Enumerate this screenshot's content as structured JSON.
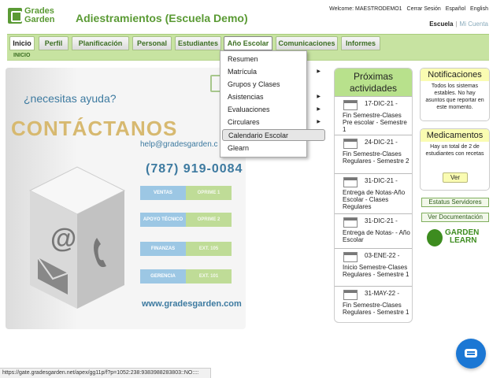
{
  "header": {
    "logo_line1": "Grades",
    "logo_line2": "Garden",
    "title": "Adiestramientos (Escuela Demo)",
    "welcome": "Welcome: MAESTRODEMO1",
    "logout": "Cerrar Sesión",
    "lang_es": "Español",
    "lang_en": "English",
    "school_current": "Escuela",
    "school_separator": "|",
    "school_link": "Mi Cuenta"
  },
  "nav": {
    "tabs": [
      "Inicio",
      "Perfil",
      "Planificación",
      "Personal",
      "Estudiantes",
      "Año Escolar",
      "Comunicaciones",
      "Informes"
    ],
    "active": "Inicio",
    "open": "Año Escolar",
    "breadcrumb": "INICIO"
  },
  "dropdown": {
    "items": [
      {
        "label": "Resumen",
        "submenu": false
      },
      {
        "label": "Matrícula",
        "submenu": true
      },
      {
        "label": "Grupos y Clases",
        "submenu": false
      },
      {
        "label": "Asistencias",
        "submenu": true
      },
      {
        "label": "Evaluaciones",
        "submenu": true
      },
      {
        "label": "Circulares",
        "submenu": true
      },
      {
        "label": "Calendario Escolar",
        "submenu": false
      },
      {
        "label": "Glearn",
        "submenu": false
      }
    ],
    "highlighted": "Calendario Escolar",
    "submenu_arrow": "▶"
  },
  "promo": {
    "help": "¿necesitas ayuda?",
    "contact": "CONTÁCTANOS",
    "email": "help@gradesgarden.c",
    "phone": "(787) 919-0084",
    "rows": [
      {
        "label": "VENTAS",
        "value": "OPRIME 1"
      },
      {
        "label": "APOYO TÉCNICO",
        "value": "OPRIME 2"
      },
      {
        "label": "FINANZAS",
        "value": "EXT. 105"
      },
      {
        "label": "GERENCIA",
        "value": "EXT. 101"
      }
    ],
    "website": "www.gradesgarden.com"
  },
  "activities": {
    "title_line1": "Próximas",
    "title_line2": "actividades",
    "items": [
      {
        "date": "17-DIC-21 -",
        "desc": "Fin Semestre-Clases Pre escolar - Semestre 1"
      },
      {
        "date": "24-DIC-21 -",
        "desc": "Fin Semestre-Clases Regulares - Semestre 2"
      },
      {
        "date": "31-DIC-21 -",
        "desc": "Entrega de Notas-Año Escolar - Clases Regulares"
      },
      {
        "date": "31-DIC-21 -",
        "desc": "Entrega de Notas- - Año Escolar"
      },
      {
        "date": "03-ENE-22 -",
        "desc": "Inicio Semestre-Clases Regulares - Semestre 1"
      },
      {
        "date": "31-MAY-22 -",
        "desc": "Fin Semestre-Clases Regulares - Semestre 1"
      }
    ]
  },
  "notifications": {
    "title": "Notificaciones",
    "body": "Todos los sistemas estables. No hay asuntos que reportar en este momento."
  },
  "medications": {
    "title": "Medicamentos",
    "body": "Hay un total de 2 de estudiantes con recetas",
    "button": "Ver"
  },
  "side_buttons": {
    "status": "Estatus Servidores",
    "docs": "Ver Documentación"
  },
  "garden_learn": {
    "line1": "GARDEN",
    "line2": "LEARN"
  },
  "statusbar": {
    "url": "https://gate.gradesgarden.net/apex/gg11p/f?p=1052:238:9383988283803::NO::::"
  },
  "colors": {
    "brand_green": "#5a9a34",
    "nav_green": "#c7e3a1",
    "activity_header": "#b8e18c",
    "notice_yellow": "#fafcb2",
    "accent_blue": "#3d7aa0",
    "chat_blue": "#1b77d4"
  }
}
